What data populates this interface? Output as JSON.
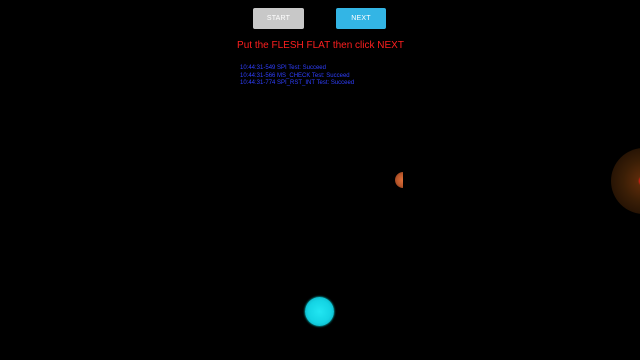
{
  "toolbar": {
    "start_label": "START",
    "next_label": "NEXT"
  },
  "instruction": "Put the FLESH FLAT then click NEXT",
  "log": [
    "10:44:31-549 SPI Test: Succeed",
    "10:44:31-566 MS_CHECK Test: Succeed",
    "10:44:31-774 SPI_RST_INT Test: Succeed"
  ],
  "colors": {
    "background": "#000000",
    "start_button": "#c8c8c8",
    "next_button": "#33b5e5",
    "instruction_text": "#ff1f1f",
    "log_text": "#2f3fff",
    "touch_indicator": "#14d4e4"
  }
}
